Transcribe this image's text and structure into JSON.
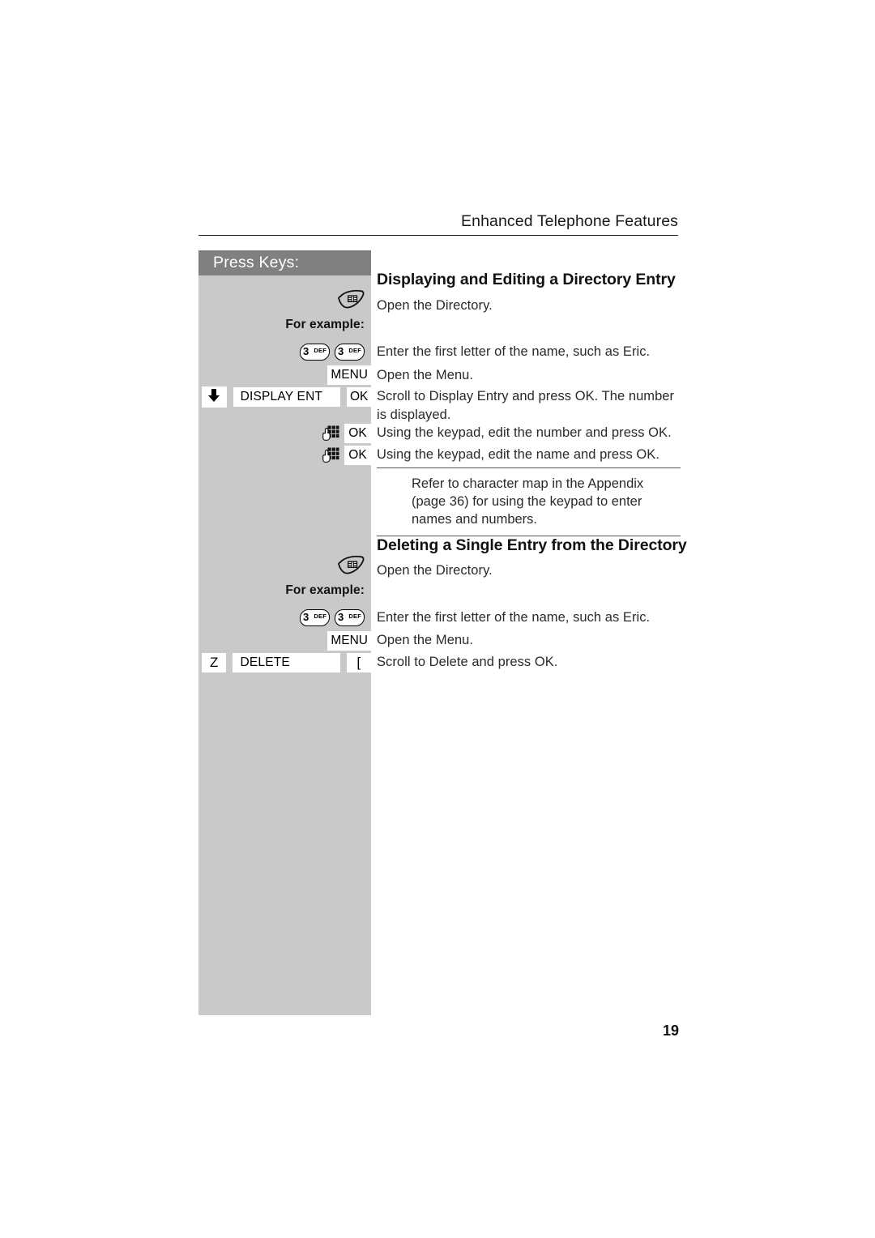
{
  "header": {
    "title": "Enhanced Telephone Features"
  },
  "sidebar": {
    "title": "Press Keys:",
    "for_example_label": "For example:",
    "bg_color": "#c9c9c9",
    "title_bg_color": "#808080"
  },
  "sections": [
    {
      "heading": "Displaying and Editing a Directory Entry",
      "steps": [
        {
          "keys": [
            {
              "type": "directory-key"
            }
          ],
          "text": "Open the Directory."
        },
        {
          "keys": [
            {
              "type": "numkey",
              "digit": "3",
              "letters": "DEF"
            },
            {
              "type": "numkey",
              "digit": "3",
              "letters": "DEF"
            }
          ],
          "text": "Enter the first letter of the name, such as Eric."
        },
        {
          "keys": [
            {
              "type": "softkey",
              "label": "MENU"
            }
          ],
          "text": "Open the Menu."
        },
        {
          "keys": [
            {
              "type": "arrow-down"
            },
            {
              "type": "display-field",
              "label": "DISPLAY ENT"
            },
            {
              "type": "softkey",
              "label": "OK"
            }
          ],
          "text": "Scroll to Display Entry and press OK. The number is displayed."
        },
        {
          "keys": [
            {
              "type": "keypad-icon"
            },
            {
              "type": "softkey",
              "label": "OK"
            }
          ],
          "text": "Using the keypad, edit the number and press OK."
        },
        {
          "keys": [
            {
              "type": "keypad-icon"
            },
            {
              "type": "softkey",
              "label": "OK"
            }
          ],
          "text": "Using the keypad, edit the name and press OK."
        }
      ],
      "note": "Refer to character map in the Appendix (page 36) for using the keypad to enter names and numbers."
    },
    {
      "heading": "Deleting a Single Entry from the Directory",
      "steps": [
        {
          "keys": [
            {
              "type": "directory-key"
            }
          ],
          "text": "Open the Directory."
        },
        {
          "keys": [
            {
              "type": "numkey",
              "digit": "3",
              "letters": "DEF"
            },
            {
              "type": "numkey",
              "digit": "3",
              "letters": "DEF"
            }
          ],
          "text": "Enter the first letter of the name, such as Eric."
        },
        {
          "keys": [
            {
              "type": "softkey",
              "label": "MENU"
            }
          ],
          "text": "Open the Menu."
        },
        {
          "keys": [
            {
              "type": "symbol",
              "label": "Z"
            },
            {
              "type": "display-field",
              "label": "DELETE"
            },
            {
              "type": "symbol",
              "label": "["
            }
          ],
          "text": "Scroll to Delete and press OK."
        }
      ]
    }
  ],
  "labels": {
    "menu": "MENU",
    "ok": "OK",
    "display_ent": "DISPLAY ENT",
    "delete": "DELETE",
    "sym_scroll": "Z",
    "sym_ok": "["
  },
  "body_text": {
    "open_directory_1": "Open the Directory.",
    "enter_first_letter_1": "Enter the first letter of the name, such as Eric.",
    "open_menu_1": "Open the Menu.",
    "scroll_display": "Scroll to Display Entry and press OK. The number is displayed.",
    "edit_number": "Using the keypad, edit the number and press OK.",
    "edit_name": "Using the keypad, edit the name and press OK.",
    "note": "Refer to character map in the Appendix (page 36) for using the keypad to enter names and numbers.",
    "open_directory_2": "Open the Directory.",
    "enter_first_letter_2": "Enter the first letter of the name, such as Eric.",
    "open_menu_2": "Open the Menu.",
    "scroll_delete": "Scroll to Delete and press OK."
  },
  "headings": {
    "section1": "Displaying and Editing a Directory Entry",
    "section2": "Deleting a Single Entry from the Directory"
  },
  "footer": {
    "page_number": "19"
  }
}
